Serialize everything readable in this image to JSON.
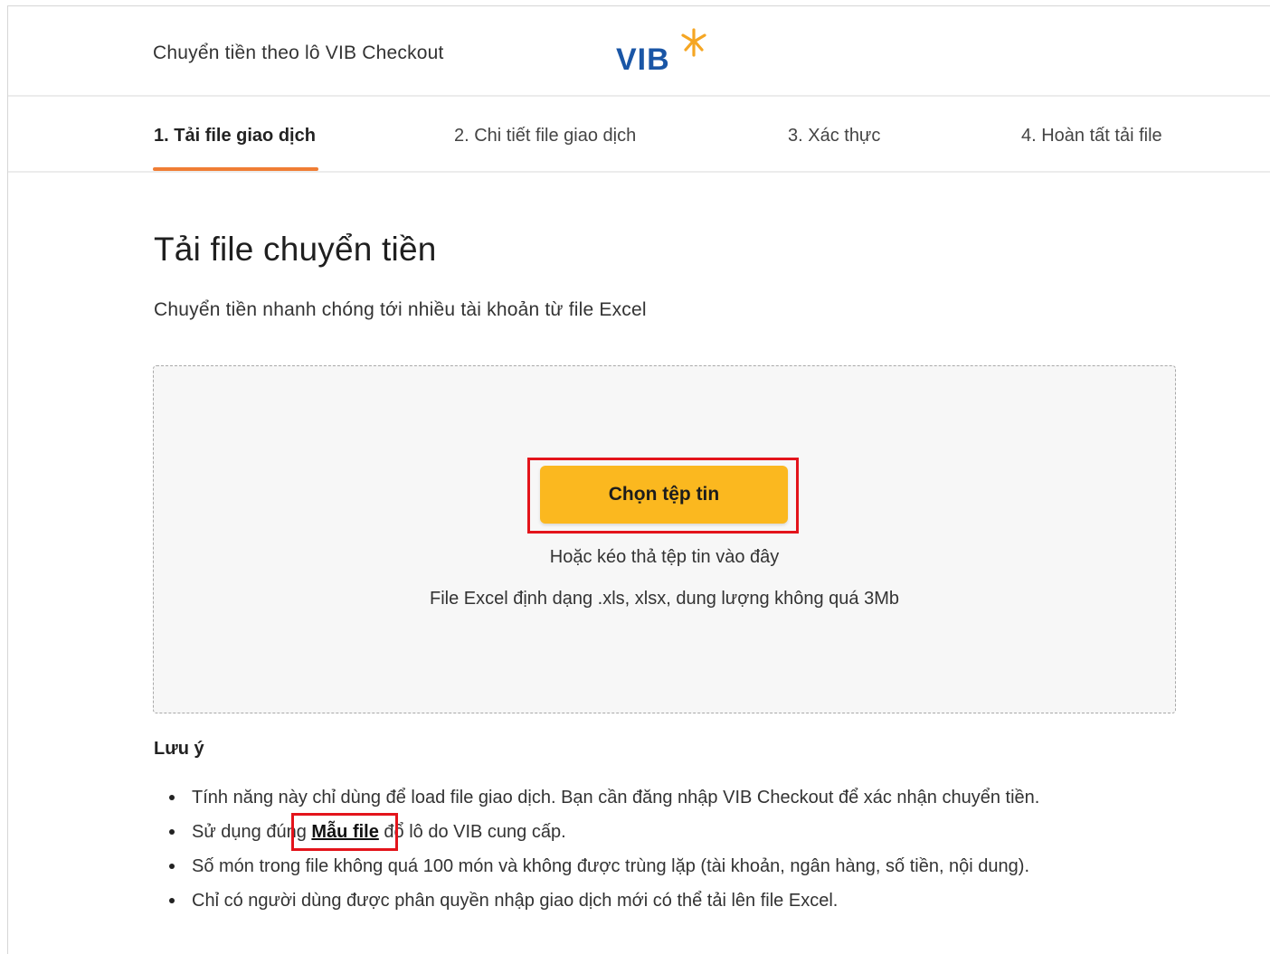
{
  "header": {
    "title": "Chuyển tiền theo lô VIB Checkout",
    "logo_text": "VIB",
    "logo_color": "#1a56a6",
    "logo_star_color": "#f5a623"
  },
  "steps": [
    {
      "label": "1. Tải file giao dịch",
      "active": true
    },
    {
      "label": "2. Chi tiết file giao dịch",
      "active": false
    },
    {
      "label": "3. Xác thực",
      "active": false
    },
    {
      "label": "4. Hoàn tất tải file",
      "active": false
    }
  ],
  "main": {
    "title": "Tải file chuyển tiền",
    "subtitle": "Chuyển tiền nhanh chóng tới nhiều tài khoản từ file Excel"
  },
  "dropzone": {
    "button_label": "Chọn tệp tin",
    "hint": "Hoặc kéo thả tệp tin vào đây",
    "format": "File Excel định dạng .xls, xlsx, dung lượng không quá 3Mb"
  },
  "notes": {
    "title": "Lưu ý",
    "item1": "Tính năng này chỉ dùng để load file giao dịch. Bạn cần đăng nhập VIB Checkout để xác nhận chuyển tiền.",
    "item2_before": "Sử dụng đúng ",
    "item2_link": "Mẫu file",
    "item2_after": " đổ lô do VIB cung cấp.",
    "item3": "Số món trong file không quá 100 món và không được trùng lặp (tài khoản, ngân hàng, số tiền, nội dung).",
    "item4": "Chỉ có người dùng được phân quyền nhập giao dịch mới có thể tải lên file Excel."
  },
  "colors": {
    "accent_orange": "#f07d34",
    "button_yellow": "#fbb81f",
    "highlight_red": "#e3141b"
  }
}
